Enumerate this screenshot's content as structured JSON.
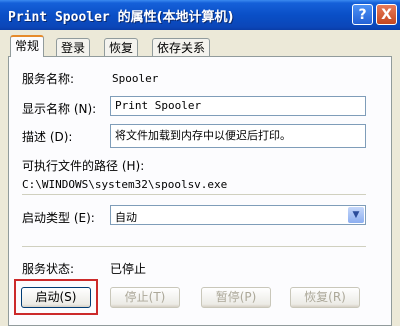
{
  "window": {
    "title_mono": "Print Spooler",
    "title_cn": "的属性(本地计算机)",
    "help_label": "?",
    "close_label": "X"
  },
  "tabs": [
    {
      "label": "常规"
    },
    {
      "label": "登录"
    },
    {
      "label": "恢复"
    },
    {
      "label": "依存关系"
    }
  ],
  "general": {
    "service_name_label": "服务名称:",
    "service_name_value": "Spooler",
    "display_name_label": "显示名称 (N):",
    "display_name_value": "Print Spooler",
    "description_label": "描述 (D):",
    "description_value": "将文件加载到内存中以便迟后打印。",
    "exe_path_label": "可执行文件的路径 (H):",
    "exe_path_value": "C:\\WINDOWS\\system32\\spoolsv.exe",
    "startup_type_label": "启动类型 (E):",
    "startup_type_value": "自动",
    "status_label": "服务状态:",
    "status_value": "已停止"
  },
  "buttons": {
    "start": "启动(S)",
    "stop": "停止(T)",
    "pause": "暂停(P)",
    "resume": "恢复(R)"
  },
  "colors": {
    "titlebar": "#0A4FC7",
    "highlight": "#CC2A2A",
    "active_tab_accent": "#E68B2C"
  }
}
